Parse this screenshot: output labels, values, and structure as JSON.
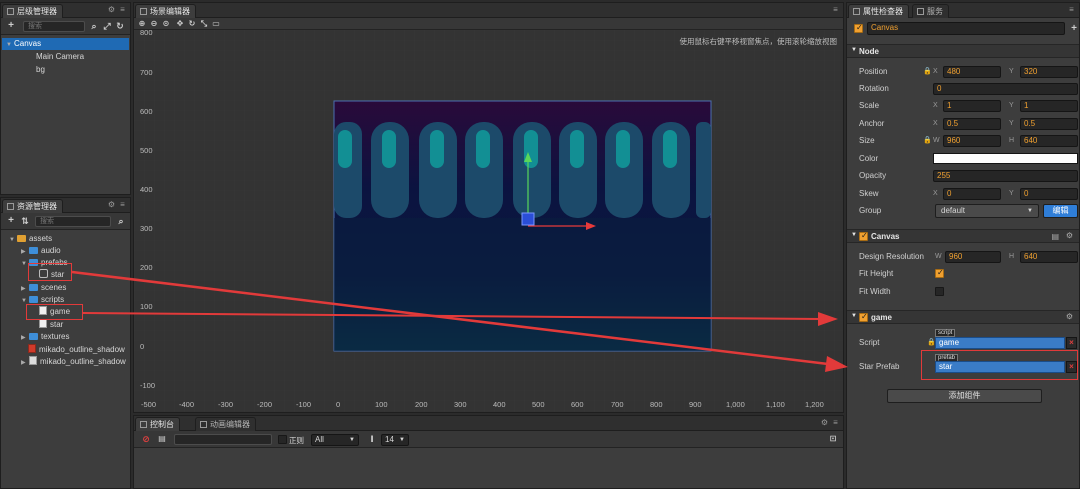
{
  "hierarchy": {
    "tab_title": "层级管理器",
    "search_placeholder": "搜索",
    "nodes": [
      {
        "label": "Canvas",
        "selected": true
      },
      {
        "label": "Main Camera",
        "selected": false
      },
      {
        "label": "bg",
        "selected": false
      }
    ]
  },
  "assets": {
    "tab_title": "资源管理器",
    "search_placeholder": "搜索",
    "items": [
      {
        "label": "assets",
        "type": "root"
      },
      {
        "label": "audio",
        "type": "folder"
      },
      {
        "label": "prefabs",
        "type": "folder"
      },
      {
        "label": "star",
        "type": "prefab"
      },
      {
        "label": "scenes",
        "type": "folder"
      },
      {
        "label": "scripts",
        "type": "folder"
      },
      {
        "label": "game",
        "type": "script"
      },
      {
        "label": "star",
        "type": "script"
      },
      {
        "label": "textures",
        "type": "folder"
      },
      {
        "label": "mikado_outline_shadow",
        "type": "font"
      },
      {
        "label": "mikado_outline_shadow",
        "type": "png"
      }
    ]
  },
  "scene": {
    "tab_title": "场景编辑器",
    "hint": "使用鼠标右键平移视窗焦点，使用滚轮缩放视图",
    "y_ticks": [
      "800",
      "700",
      "600",
      "500",
      "400",
      "300",
      "200",
      "100",
      "0",
      "-100"
    ],
    "x_ticks": [
      "-500",
      "-400",
      "-300",
      "-200",
      "-100",
      "0",
      "100",
      "200",
      "300",
      "400",
      "500",
      "600",
      "700",
      "800",
      "900",
      "1,000",
      "1,100",
      "1,200"
    ]
  },
  "console": {
    "tab_title": "控制台",
    "tab2_title": "动画编辑器",
    "regex_label": "正则",
    "filter_value": "All",
    "font_size_value": "14"
  },
  "inspector": {
    "tab_title": "属性检查器",
    "tab2_title": "服务",
    "node_name": "Canvas",
    "node_section": "Node",
    "position_label": "Position",
    "position_x": "480",
    "position_y": "320",
    "rotation_label": "Rotation",
    "rotation": "0",
    "scale_label": "Scale",
    "scale_x": "1",
    "scale_y": "1",
    "anchor_label": "Anchor",
    "anchor_x": "0.5",
    "anchor_y": "0.5",
    "size_label": "Size",
    "size_w": "960",
    "size_h": "640",
    "color_label": "Color",
    "color_value": "#ffffff",
    "opacity_label": "Opacity",
    "opacity": "255",
    "skew_label": "Skew",
    "skew_x": "0",
    "skew_y": "0",
    "group_label": "Group",
    "group_value": "default",
    "group_edit": "编辑",
    "canvas_section": "Canvas",
    "design_res_label": "Design Resolution",
    "design_w": "960",
    "design_h": "640",
    "fit_height_label": "Fit Height",
    "fit_height": true,
    "fit_width_label": "Fit Width",
    "fit_width": false,
    "game_section": "game",
    "script_label": "Script",
    "script_tag": "script",
    "script_value": "game",
    "star_prefab_label": "Star Prefab",
    "prefab_tag": "prefab",
    "star_prefab_value": "star",
    "add_component": "添加组件",
    "axis_x": "X",
    "axis_y": "Y",
    "axis_w": "W",
    "axis_h": "H"
  },
  "colors": {
    "accent": "#f0a030",
    "selection": "#1f6ab4",
    "annotation": "#e23a3a"
  }
}
